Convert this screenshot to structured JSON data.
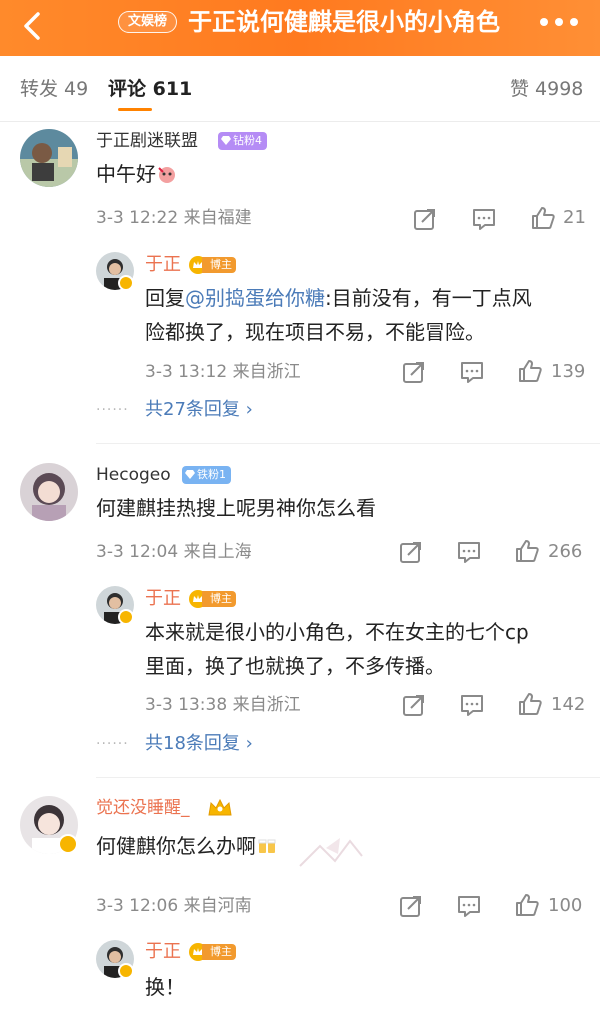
{
  "header": {
    "badge": "文娱榜",
    "title": "于正说何健麒是很小的小角色"
  },
  "tabs": {
    "repost": "转发 49",
    "comments": "评论 611",
    "likes": "赞 4998"
  },
  "comments": [
    {
      "user": "于正剧迷联盟",
      "fan_badge": "钻粉4",
      "text": "中午好",
      "time_location": "3-3 12:22  来自福建",
      "likes": "21",
      "reply": {
        "user": "于正",
        "badge": "博主",
        "prefix": "回复",
        "mention": "@别捣蛋给你糖",
        "line1": ":目前没有，有一丁点风",
        "line2": "险都换了，现在项目不易，不能冒险。",
        "time_location": "3-3 13:12  来自浙江",
        "likes": "139"
      },
      "more_replies": "共27条回复"
    },
    {
      "user": "Hecogeo",
      "fan_badge": "铁粉1",
      "text": "何建麒挂热搜上呢男神你怎么看",
      "time_location": "3-3 12:04  来自上海",
      "likes": "266",
      "reply": {
        "user": "于正",
        "badge": "博主",
        "line1": "本来就是很小的小角色，不在女主的七个cp",
        "line2": "里面，换了也就换了，不多传播。",
        "time_location": "3-3 13:38  来自浙江",
        "likes": "142"
      },
      "more_replies": "共18条回复"
    },
    {
      "user": "觉还没睡醒_",
      "text": "何健麒你怎么办啊",
      "time_location": "3-3 12:06  来自河南",
      "likes": "100",
      "reply": {
        "user": "于正",
        "badge": "博主",
        "text": "换！"
      }
    }
  ],
  "colors": {
    "accent": "#ff8200",
    "header_bg": "#ff7a1f",
    "link": "#4b7bb8",
    "username_orange": "#eb7350",
    "meta_gray": "#8a8a8a"
  }
}
